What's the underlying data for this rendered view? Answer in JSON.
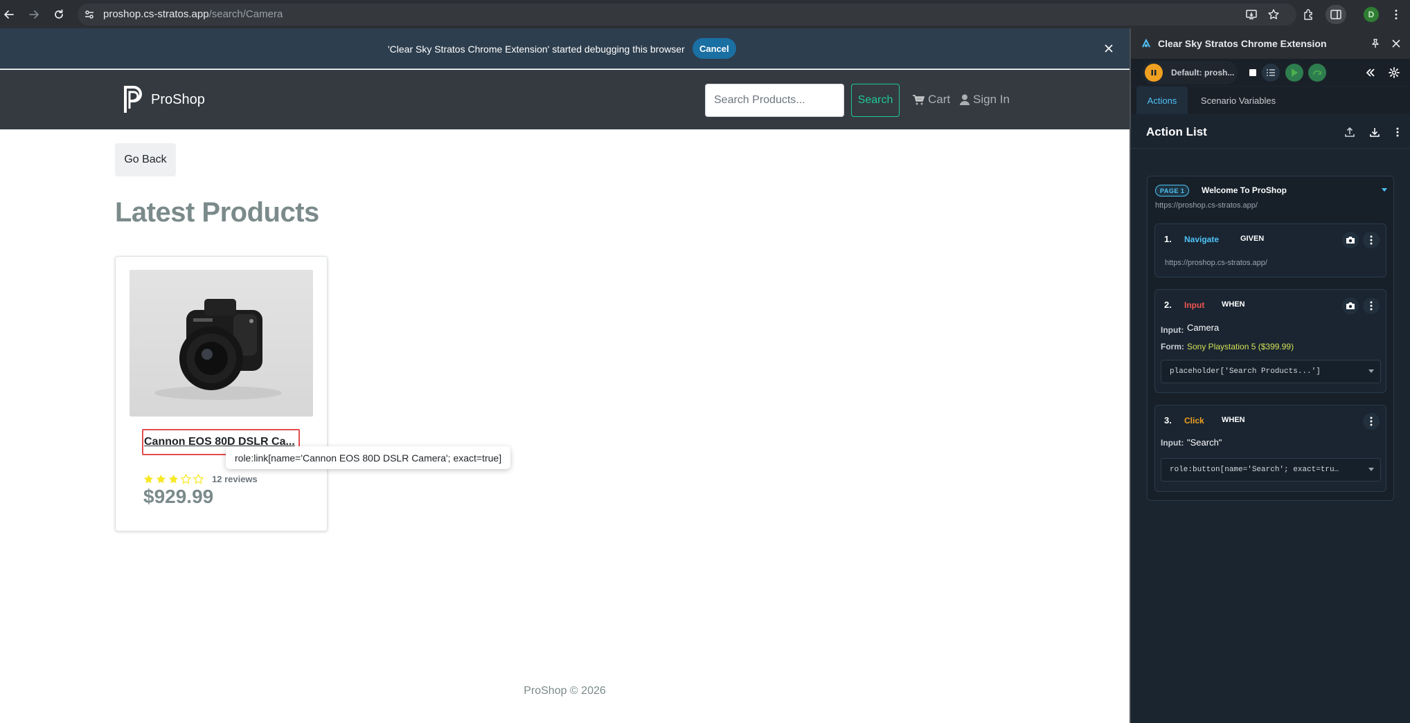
{
  "browser": {
    "url_host": "proshop.cs-stratos.app",
    "url_path": "/search/Camera",
    "profile_initial": "D"
  },
  "debug_banner": {
    "message": "'Clear Sky Stratos Chrome Extension' started debugging this browser",
    "cancel_label": "Cancel"
  },
  "header": {
    "brand": "ProShop",
    "search_placeholder": "Search Products...",
    "search_button": "Search",
    "cart_label": "Cart",
    "signin_label": "Sign In"
  },
  "main": {
    "go_back_label": "Go Back",
    "section_title": "Latest Products",
    "product": {
      "name": "Cannon EOS 80D DSLR Ca...",
      "rating": 3,
      "rating_max": 5,
      "reviews_label": "12 reviews",
      "price": "$929.99"
    },
    "tooltip": "role:link[name='Cannon EOS 80D DSLR Camera'; exact=true]",
    "footer": "ProShop © 2026"
  },
  "extension": {
    "title": "Clear Sky Stratos Chrome Extension",
    "scenario": "Default: prosh...",
    "tabs": [
      "Actions",
      "Scenario Variables"
    ],
    "action_list_title": "Action List",
    "page_group": {
      "badge": "PAGE 1",
      "title": "Welcome To ProShop",
      "url": "https://proshop.cs-stratos.app/"
    },
    "steps": [
      {
        "number": "1.",
        "type": "Navigate",
        "keyword": "GIVEN",
        "detail": "https://proshop.cs-stratos.app/"
      },
      {
        "number": "2.",
        "type": "Input",
        "keyword": "WHEN",
        "input_label": "Input:",
        "input_value": "Camera",
        "form_label": "Form:",
        "form_value": "Sony Playstation 5 ($399.99)",
        "locator": "placeholder['Search Products...']"
      },
      {
        "number": "3.",
        "type": "Click",
        "keyword": "WHEN",
        "input_label": "Input:",
        "input_value": "\"Search\"",
        "locator": "role:button[name='Search'; exact=tru…"
      }
    ],
    "colors": {
      "navigate": "#4fc3f7",
      "input": "#ef5350",
      "click": "#f0a020",
      "form_value": "#d4e157"
    }
  }
}
